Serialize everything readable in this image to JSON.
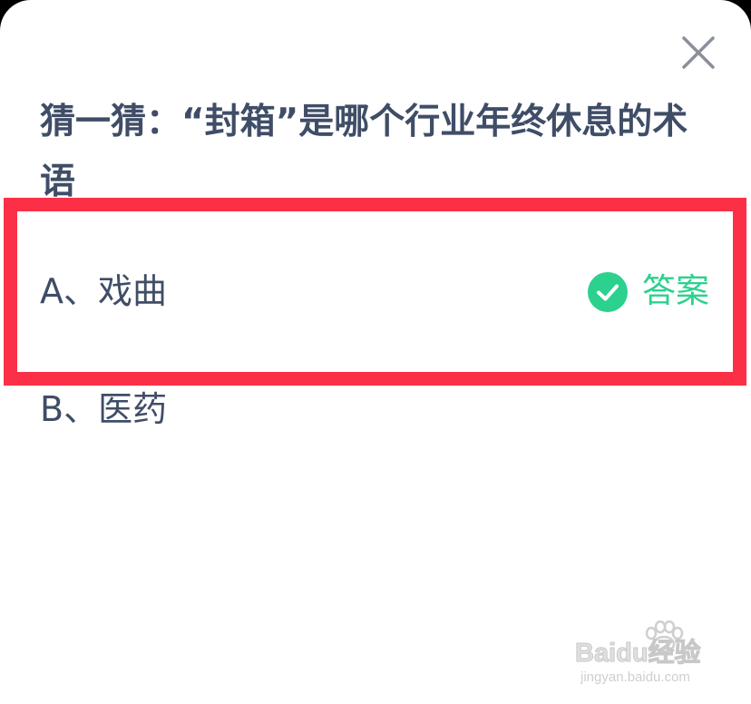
{
  "dialog": {
    "question": "猜一猜：“封箱”是哪个行业年终休息的术语",
    "close_icon": "close-icon"
  },
  "options": [
    {
      "label": "A、戏曲",
      "is_answer": true,
      "answer_label": "答案",
      "answer_icon": "check-circle-icon",
      "answer_color": "#2cd18d"
    },
    {
      "label": "B、医药",
      "is_answer": false
    }
  ],
  "highlight": {
    "color": "#fb3047"
  },
  "watermark": {
    "brand": "Baidu经验",
    "url": "jingyan.baidu.com",
    "icon": "paw-icon"
  }
}
